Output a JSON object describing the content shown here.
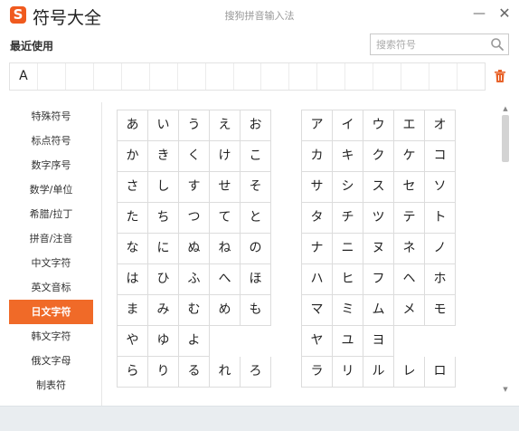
{
  "titlebar": {
    "logo_glyph": "S",
    "app_title": "符号大全",
    "window_title": "搜狗拼音输入法",
    "minimize": "—",
    "close": "✕"
  },
  "recent": {
    "label": "最近使用",
    "items": [
      "A",
      "",
      "",
      "",
      "",
      "",
      "",
      "",
      "",
      "",
      "",
      "",
      "",
      "",
      "",
      "",
      ""
    ]
  },
  "search": {
    "placeholder": "搜索符号",
    "value": ""
  },
  "sidebar": {
    "items": [
      {
        "label": "特殊符号",
        "active": false
      },
      {
        "label": "标点符号",
        "active": false
      },
      {
        "label": "数字序号",
        "active": false
      },
      {
        "label": "数学/单位",
        "active": false
      },
      {
        "label": "希腊/拉丁",
        "active": false
      },
      {
        "label": "拼音/注音",
        "active": false
      },
      {
        "label": "中文字符",
        "active": false
      },
      {
        "label": "英文音标",
        "active": false
      },
      {
        "label": "日文字符",
        "active": true
      },
      {
        "label": "韩文字符",
        "active": false
      },
      {
        "label": "俄文字母",
        "active": false
      },
      {
        "label": "制表符",
        "active": false
      }
    ]
  },
  "hiragana": [
    [
      "あ",
      "い",
      "う",
      "え",
      "お"
    ],
    [
      "か",
      "き",
      "く",
      "け",
      "こ"
    ],
    [
      "さ",
      "し",
      "す",
      "せ",
      "そ"
    ],
    [
      "た",
      "ち",
      "つ",
      "て",
      "と"
    ],
    [
      "な",
      "に",
      "ぬ",
      "ね",
      "の"
    ],
    [
      "は",
      "ひ",
      "ふ",
      "へ",
      "ほ"
    ],
    [
      "ま",
      "み",
      "む",
      "め",
      "も"
    ],
    [
      "や",
      "ゆ",
      "よ",
      "",
      ""
    ],
    [
      "ら",
      "り",
      "る",
      "れ",
      "ろ"
    ]
  ],
  "katakana": [
    [
      "ア",
      "イ",
      "ウ",
      "エ",
      "オ"
    ],
    [
      "カ",
      "キ",
      "ク",
      "ケ",
      "コ"
    ],
    [
      "サ",
      "シ",
      "ス",
      "セ",
      "ソ"
    ],
    [
      "タ",
      "チ",
      "ツ",
      "テ",
      "ト"
    ],
    [
      "ナ",
      "ニ",
      "ヌ",
      "ネ",
      "ノ"
    ],
    [
      "ハ",
      "ヒ",
      "フ",
      "ヘ",
      "ホ"
    ],
    [
      "マ",
      "ミ",
      "ム",
      "メ",
      "モ"
    ],
    [
      "ヤ",
      "ユ",
      "ヨ",
      "",
      ""
    ],
    [
      "ラ",
      "リ",
      "ル",
      "レ",
      "ロ"
    ]
  ],
  "colors": {
    "accent": "#f06a28",
    "logo": "#f05a1e",
    "trash": "#e8632a"
  }
}
